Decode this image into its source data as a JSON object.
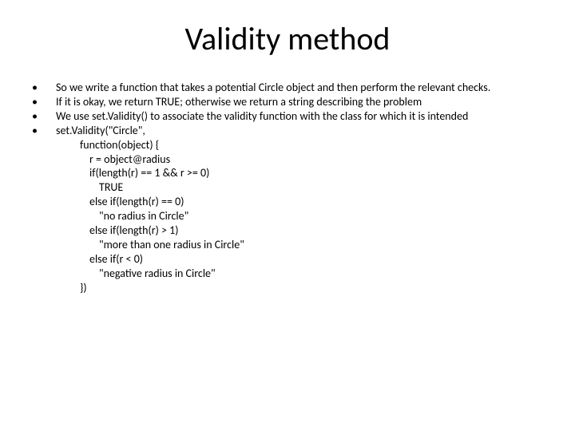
{
  "title": "Validity method",
  "bullets": [
    "So we write a function that takes a potential Circle object and then perform the relevant checks.",
    "If it is okay, we return TRUE; otherwise we return a string describing the problem",
    "We use set.Validity() to associate the validity function with the class for which it is intended",
    "set.Validity(\"Circle\","
  ],
  "code": [
    "function(object) {",
    "r = object@radius",
    "if(length(r) == 1 && r >= 0)",
    "TRUE",
    "else if(length(r) == 0)",
    "\"no radius in Circle\"",
    "else if(length(r) > 1)",
    "\"more than one radius in Circle\"",
    "else if(r < 0)",
    "\"negative radius in Circle\"",
    "})"
  ]
}
